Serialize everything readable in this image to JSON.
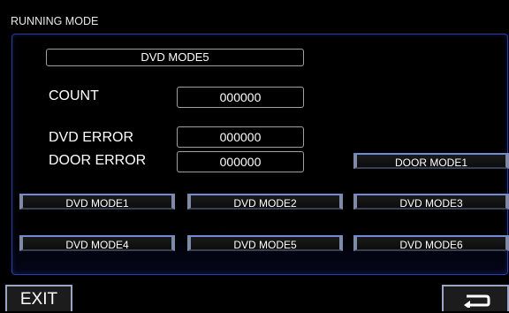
{
  "screen": {
    "title": "RUNNING MODE"
  },
  "status": {
    "mode_title": "DVD MODE5",
    "count_label": "COUNT",
    "count_value": "000000",
    "dvd_error_label": "DVD ERROR",
    "dvd_error_value": "000000",
    "door_error_label": "DOOR ERROR",
    "door_error_value": "000000"
  },
  "buttons": {
    "door_mode1": "DOOR MODE1",
    "dvd_mode1": "DVD MODE1",
    "dvd_mode2": "DVD MODE2",
    "dvd_mode3": "DVD MODE3",
    "dvd_mode4": "DVD MODE4",
    "dvd_mode5": "DVD MODE5",
    "dvd_mode6": "DVD MODE6"
  },
  "footer": {
    "exit_label": "EXIT",
    "back_icon": "return-arrow-icon"
  },
  "colors": {
    "background": "#000000",
    "panel_border": "#2a3da0",
    "button_highlight": "#6f8dd6"
  }
}
